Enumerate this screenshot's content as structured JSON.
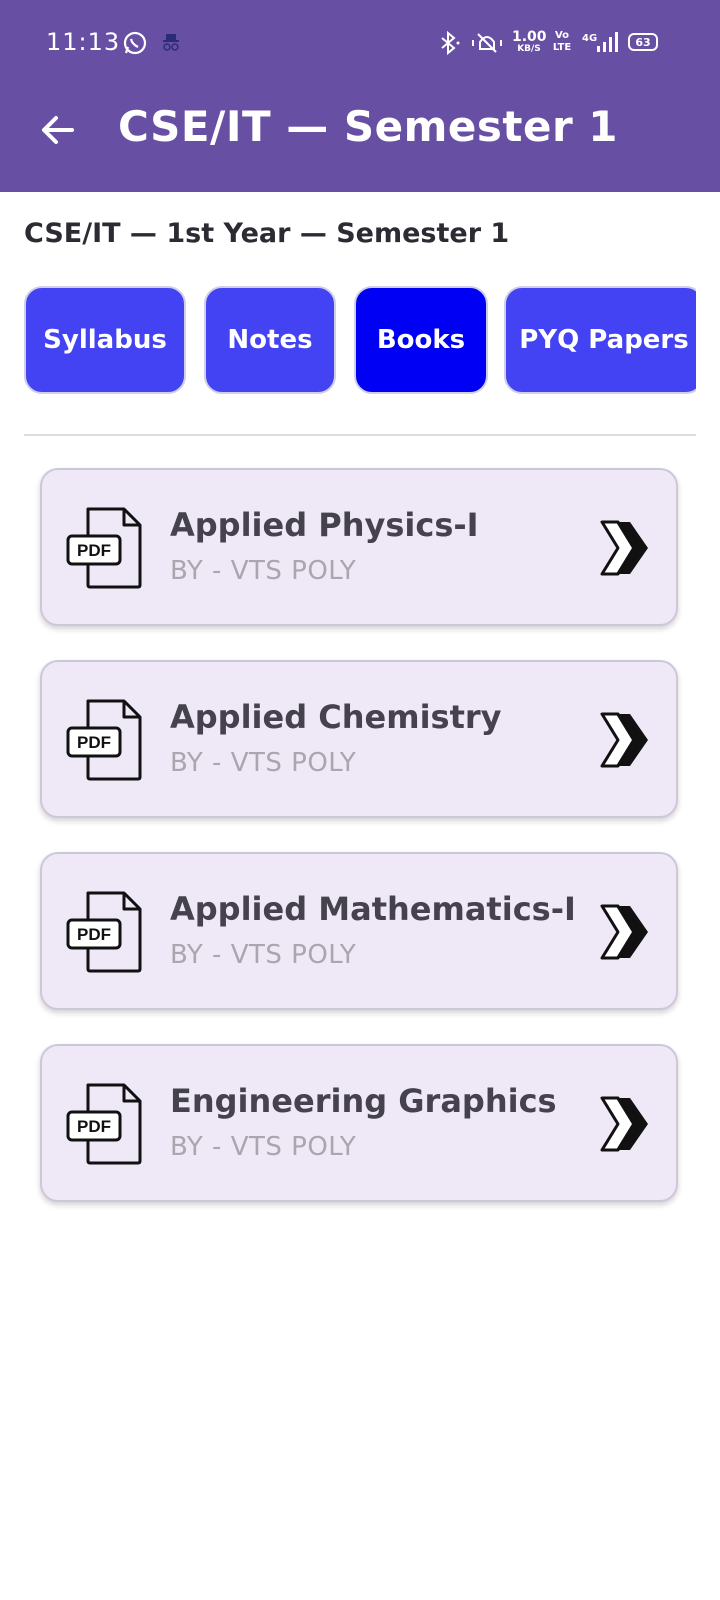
{
  "status_bar": {
    "time": "11:13",
    "network_speed": "1.00",
    "network_unit": "KB/S",
    "volte": "Vo\nLTE",
    "signal_type": "4G",
    "battery": "63",
    "icons": [
      "whatsapp-icon",
      "incognito-icon",
      "bluetooth-icon",
      "vibrate-icon",
      "signal-icon",
      "battery-icon"
    ]
  },
  "app_bar": {
    "title": "CSE/IT — Semester 1",
    "back_icon": "arrow-left-icon"
  },
  "page": {
    "subtitle": "CSE/IT — 1st Year — Semester 1"
  },
  "tabs": [
    {
      "label": "Syllabus",
      "active": false
    },
    {
      "label": "Notes",
      "active": false
    },
    {
      "label": "Books",
      "active": true
    },
    {
      "label": "PYQ Papers",
      "active": false
    }
  ],
  "books": [
    {
      "title": "Applied Physics-I",
      "author": "BY - VTS POLY"
    },
    {
      "title": "Applied Chemistry",
      "author": "BY - VTS POLY"
    },
    {
      "title": "Applied Mathematics-I",
      "author": "BY - VTS POLY"
    },
    {
      "title": "Engineering Graphics",
      "author": "BY - VTS POLY"
    }
  ],
  "pdf_label": "PDF",
  "colors": {
    "app_bar": "#6750A4",
    "tab": "#4343F3",
    "tab_active": "#0000F5",
    "card": "#EFE8F6"
  }
}
